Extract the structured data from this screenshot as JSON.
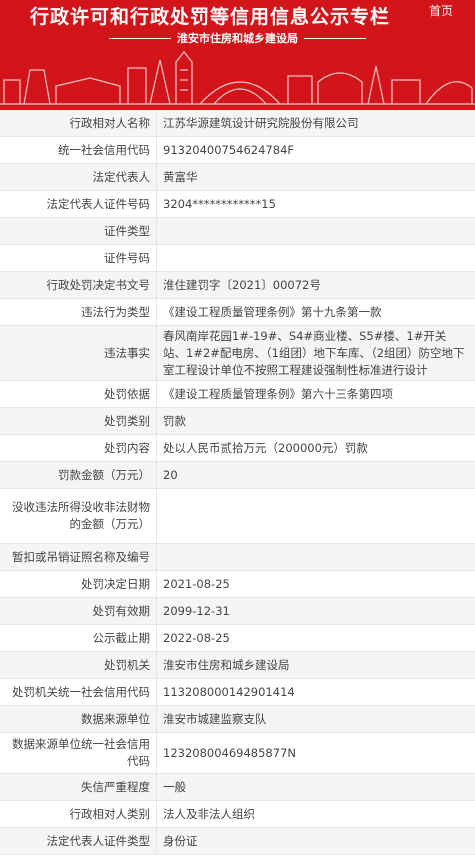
{
  "banner": {
    "title": "行政许可和行政处罚等信用信息公示专栏",
    "home": "首页",
    "subtitle": "淮安市住房和城乡建设局",
    "colors": {
      "background": "#d2151b",
      "text": "#ffffff"
    }
  },
  "rows": [
    {
      "label": "行政相对人名称",
      "value": "江苏华源建筑设计研究院股份有限公司"
    },
    {
      "label": "统一社会信用代码",
      "value": "91320400754624784F"
    },
    {
      "label": "法定代表人",
      "value": "黄富华"
    },
    {
      "label": "法定代表人证件号码",
      "value": "3204************15"
    },
    {
      "label": "证件类型",
      "value": ""
    },
    {
      "label": "证件号码",
      "value": ""
    },
    {
      "label": "行政处罚决定书文号",
      "value": "淮住建罚字〔2021〕00072号"
    },
    {
      "label": "违法行为类型",
      "value": "《建设工程质量管理条例》第十九条第一款"
    },
    {
      "label": "违法事实",
      "value": "春风南岸花园1#-19#、S4#商业楼、S5#楼、1#开关站、1#2#配电房、（1组团）地下车库、（2组团）防空地下室工程设计单位不按照工程建设强制性标准进行设计"
    },
    {
      "label": "处罚依据",
      "value": "《建设工程质量管理条例》第六十三条第四项"
    },
    {
      "label": "处罚类别",
      "value": "罚款"
    },
    {
      "label": "处罚内容",
      "value": "处以人民币贰拾万元（200000元）罚款"
    },
    {
      "label": "罚款金额（万元）",
      "value": "20"
    },
    {
      "label": "没收违法所得没收非法财物的金额（万元）",
      "value": ""
    },
    {
      "label": "暂扣或吊销证照名称及编号",
      "value": ""
    },
    {
      "label": "处罚决定日期",
      "value": "2021-08-25"
    },
    {
      "label": "处罚有效期",
      "value": "2099-12-31"
    },
    {
      "label": "公示截止期",
      "value": "2022-08-25"
    },
    {
      "label": "处罚机关",
      "value": "淮安市住房和城乡建设局"
    },
    {
      "label": "处罚机关统一社会信用代码",
      "value": "113208000142901414"
    },
    {
      "label": "数据来源单位",
      "value": "淮安市城建监察支队"
    },
    {
      "label": "数据来源单位统一社会信用代码",
      "value": "12320800469485877N"
    },
    {
      "label": "失信严重程度",
      "value": "一般"
    },
    {
      "label": "行政相对人类别",
      "value": "法人及非法人组织"
    },
    {
      "label": "法定代表人证件类型",
      "value": "身份证"
    }
  ]
}
